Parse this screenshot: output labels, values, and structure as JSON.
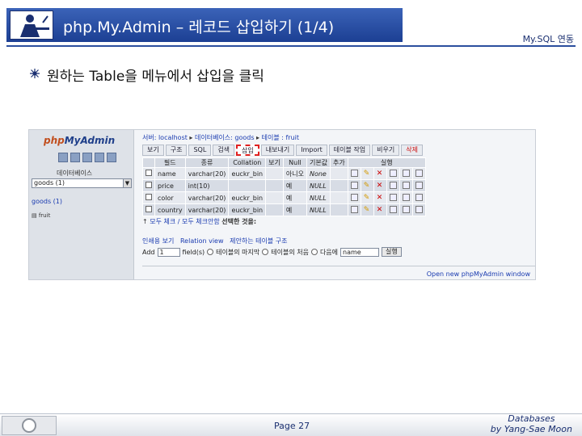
{
  "slide": {
    "title": "php.My.Admin – 레코드 삽입하기 (1/4)",
    "section": "My.SQL 연동",
    "bullet": "원하는 Table을 메뉴에서 삽입을 클릭",
    "page": "Page 27",
    "course_line1": "Databases",
    "course_line2": "by Yang-Sae Moon"
  },
  "shot": {
    "logo_prefix": "php",
    "logo_suffix": "MyAdmin",
    "left_db_label": "데이터베이스",
    "left_select": "goods (1)",
    "left_db_link": "goods (1)",
    "left_table": "fruit",
    "breadcrumb": {
      "server": "서버: localhost",
      "database": "데이터베이스: goods",
      "table": "테이블 : fruit"
    },
    "tabs": [
      "보기",
      "구조",
      "SQL",
      "검색",
      "삽입",
      "내보내기",
      "Import",
      "테이블 작업",
      "비우기",
      "삭제"
    ],
    "columns": [
      "",
      "필드",
      "종류",
      "Collation",
      "보기",
      "Null",
      "기본값",
      "추가",
      "실행"
    ],
    "rows": [
      {
        "field": "name",
        "type": "varchar(20)",
        "collation": "euckr_bin",
        "null": "아니오",
        "default": "None"
      },
      {
        "field": "price",
        "type": "int(10)",
        "collation": "",
        "null": "예",
        "default": "NULL"
      },
      {
        "field": "color",
        "type": "varchar(20)",
        "collation": "euckr_bin",
        "null": "예",
        "default": "NULL"
      },
      {
        "field": "country",
        "type": "varchar(20)",
        "collation": "euckr_bin",
        "null": "예",
        "default": "NULL"
      }
    ],
    "check_all": "모두 체크 / 모두 체크안함",
    "check_selected": "선택한 것을:",
    "print_view": "인쇄용 보기",
    "relation_view": "Relation view",
    "table_structure": "제안하는 테이블 구조",
    "add_label": "Add",
    "add_value": "1",
    "fields_label": "field(s)",
    "at_end": "테이블의 마지막",
    "at_start": "테이블의 처음",
    "after": "다음에",
    "after_select": "name",
    "go_button": "실행",
    "open_new": "Open new phpMyAdmin window"
  }
}
